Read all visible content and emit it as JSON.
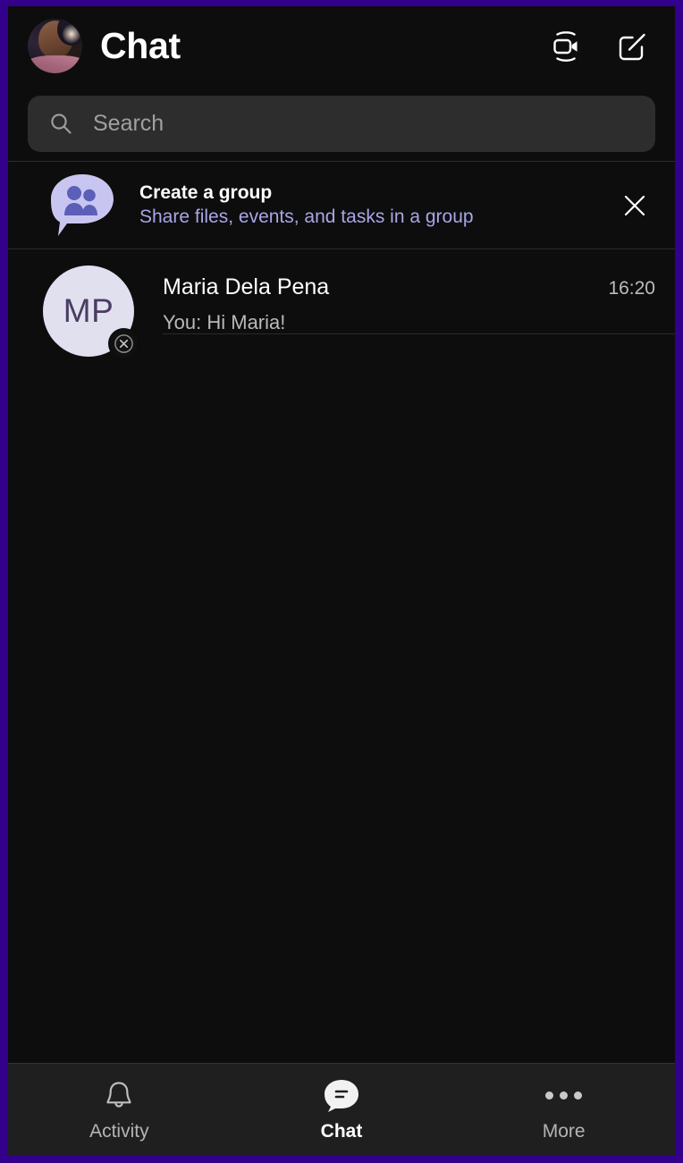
{
  "theme": {
    "frame_border_color": "#33008c",
    "app_background": "#0d0d0d",
    "nav_background": "#1f1f1f",
    "search_background": "#2d2d2d",
    "accent_purple": "#a8a6e8",
    "avatar_background": "#e1e0ef",
    "avatar_text_color": "#4a3c63",
    "group_bubble_fill": "#c8c6f0",
    "group_people_fill": "#5b5fb8"
  },
  "header": {
    "title": "Chat",
    "avatar": {
      "name": "user-profile-avatar",
      "icon": "profile-photo"
    },
    "actions": [
      {
        "name": "meet-now-button",
        "icon": "video-camera-icon",
        "label": "Meet now"
      },
      {
        "name": "new-chat-button",
        "icon": "compose-pencil-icon",
        "label": "New chat"
      }
    ]
  },
  "search": {
    "icon": "search-icon",
    "placeholder": "Search",
    "value": ""
  },
  "banner": {
    "icon": "group-chat-people-icon",
    "title": "Create a group",
    "subtitle": "Share files, events, and tasks in a group",
    "close_icon": "close-x-icon",
    "close_label": "Dismiss"
  },
  "chats": [
    {
      "initials": "MP",
      "name": "Maria Dela Pena",
      "time": "16:20",
      "preview": "You: Hi Maria!",
      "presence": "offline",
      "presence_icon": "presence-unknown-x-icon"
    }
  ],
  "bottom_nav": {
    "items": [
      {
        "label": "Activity",
        "icon": "bell-icon",
        "active": false
      },
      {
        "label": "Chat",
        "icon": "chat-bubble-filled-icon",
        "active": true
      },
      {
        "label": "More",
        "icon": "ellipsis-icon",
        "active": false
      }
    ]
  }
}
